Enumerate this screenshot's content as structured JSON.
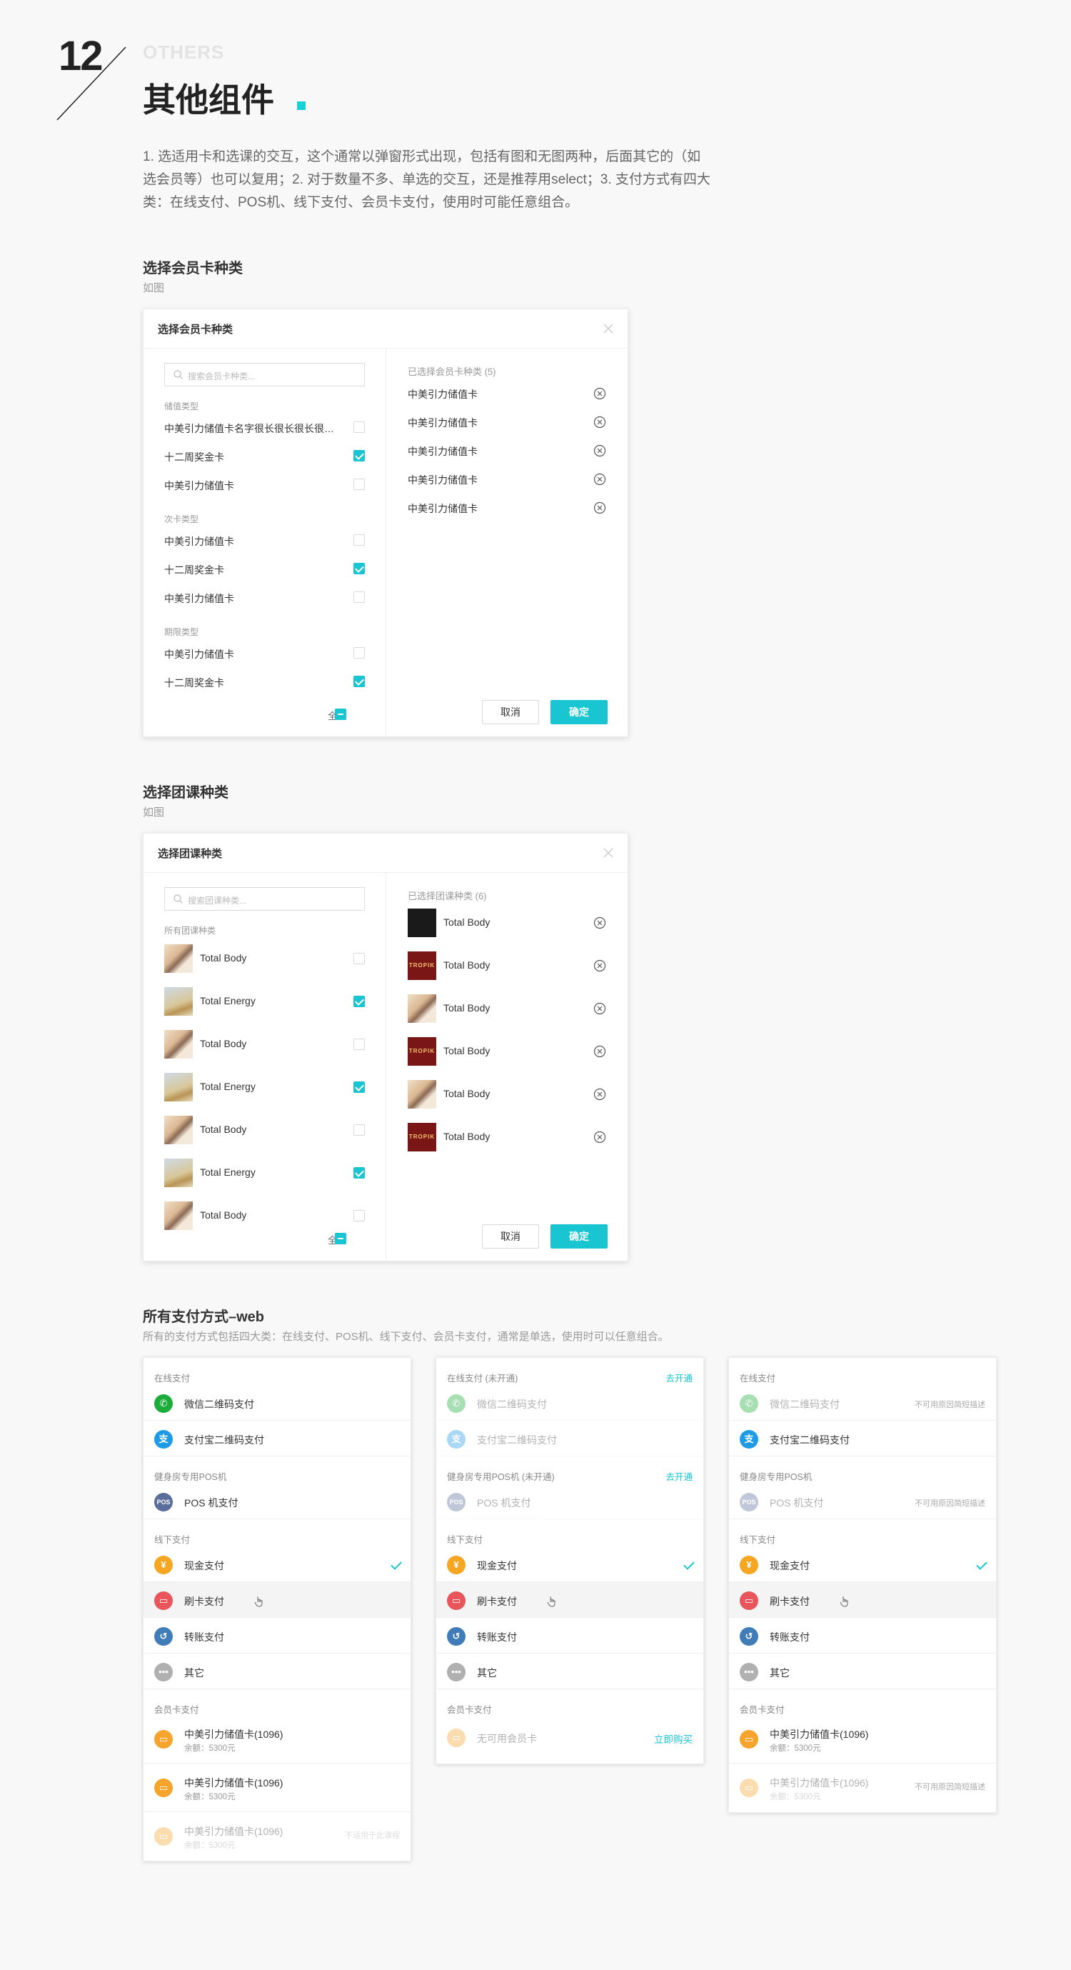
{
  "header": {
    "number": "12",
    "en_label": "OTHERS",
    "title": "其他组件",
    "intro": "1. 选适用卡和选课的交互，这个通常以弹窗形式出现，包括有图和无图两种，后面其它的（如选会员等）也可以复用；2. 对于数量不多、单选的交互，还是推荐用select；3. 支付方式有四大类：在线支付、POS机、线下支付、会员卡支付，使用时可能任意组合。"
  },
  "colors": {
    "accent": "#18c5d0",
    "text": "#333333",
    "muted": "#999999"
  },
  "card_section": {
    "title": "选择会员卡种类",
    "subtitle": "如图",
    "modal": {
      "title": "选择会员卡种类",
      "search_placeholder": "搜索会员卡种类...",
      "groups": [
        {
          "label": "储值类型",
          "items": [
            {
              "name": "中美引力储值卡名字很长很长很长很长很长",
              "checked": false
            },
            {
              "name": "十二周奖金卡",
              "checked": true
            },
            {
              "name": "中美引力储值卡",
              "checked": false
            }
          ]
        },
        {
          "label": "次卡类型",
          "items": [
            {
              "name": "中美引力储值卡",
              "checked": false
            },
            {
              "name": "十二周奖金卡",
              "checked": true
            },
            {
              "name": "中美引力储值卡",
              "checked": false
            }
          ]
        },
        {
          "label": "期限类型",
          "items": [
            {
              "name": "中美引力储值卡",
              "checked": false
            },
            {
              "name": "十二周奖金卡",
              "checked": true
            }
          ]
        }
      ],
      "select_all": "全选",
      "selected_header": "已选择会员卡种类 (5)",
      "selected": [
        "中美引力储值卡",
        "中美引力储值卡",
        "中美引力储值卡",
        "中美引力储值卡",
        "中美引力储值卡"
      ],
      "cancel": "取消",
      "confirm": "确定"
    }
  },
  "class_section": {
    "title": "选择团课种类",
    "subtitle": "如图",
    "modal": {
      "title": "选择团课种类",
      "search_placeholder": "搜索团课种类...",
      "group_label": "所有团课种类",
      "items": [
        {
          "name": "Total Body",
          "checked": false,
          "thumb": "body"
        },
        {
          "name": "Total Energy",
          "checked": true,
          "thumb": "energy"
        },
        {
          "name": "Total Body",
          "checked": false,
          "thumb": "body"
        },
        {
          "name": "Total Energy",
          "checked": true,
          "thumb": "energy"
        },
        {
          "name": "Total Body",
          "checked": false,
          "thumb": "body"
        },
        {
          "name": "Total Energy",
          "checked": true,
          "thumb": "energy"
        },
        {
          "name": "Total Body",
          "checked": false,
          "thumb": "body"
        }
      ],
      "select_all": "全选",
      "selected_header": "已选择团课种类 (6)",
      "selected": [
        {
          "name": "Total Body",
          "thumb": "dark"
        },
        {
          "name": "Total Body",
          "thumb": "tropik"
        },
        {
          "name": "Total Body",
          "thumb": "body"
        },
        {
          "name": "Total Body",
          "thumb": "tropik"
        },
        {
          "name": "Total Body",
          "thumb": "body"
        },
        {
          "name": "Total Body",
          "thumb": "tropik"
        }
      ],
      "tropik_text": "TROPIK",
      "cancel": "取消",
      "confirm": "确定"
    }
  },
  "payment_section": {
    "title": "所有支付方式–web",
    "subtitle": "所有的支付方式包括四大类：在线支付、POS机、线下支付、会员卡支付，通常是单选，使用时可以任意组合。",
    "cards": [
      {
        "online_label": "在线支付",
        "online_link": "",
        "wechat": "微信二维码支付",
        "wechat_note": "",
        "wechat_dim": false,
        "alipay": "支付宝二维码支付",
        "alipay_dim": false,
        "pos_label": "健身房专用POS机",
        "pos_link": "",
        "pos": "POS 机支付",
        "pos_note": "",
        "pos_dim": false,
        "offline_label": "线下支付",
        "cash": "现金支付",
        "card": "刷卡支付",
        "transfer": "转账支付",
        "other": "其它",
        "member_label": "会员卡支付",
        "members": [
          {
            "name": "中美引力储值卡(1096)",
            "balance": "余额：5300元",
            "note": "",
            "dim": false
          },
          {
            "name": "中美引力储值卡(1096)",
            "balance": "余额：5300元",
            "note": "",
            "dim": false
          },
          {
            "name": "中美引力储值卡(1096)",
            "balance": "余额：5300元",
            "note": "不适用于此课程",
            "dim": true
          }
        ]
      },
      {
        "online_label": "在线支付 (未开通)",
        "online_link": "去开通",
        "wechat": "微信二维码支付",
        "wechat_note": "",
        "wechat_dim": true,
        "alipay": "支付宝二维码支付",
        "alipay_dim": true,
        "pos_label": "健身房专用POS机 (未开通)",
        "pos_link": "去开通",
        "pos": "POS 机支付",
        "pos_note": "",
        "pos_dim": true,
        "offline_label": "线下支付",
        "cash": "现金支付",
        "card": "刷卡支付",
        "transfer": "转账支付",
        "other": "其它",
        "member_label": "会员卡支付",
        "no_member": "无可用会员卡",
        "buy_now": "立即购买"
      },
      {
        "online_label": "在线支付",
        "online_link": "",
        "wechat": "微信二维码支付",
        "wechat_note": "不可用原因简短描述",
        "wechat_dim": true,
        "alipay": "支付宝二维码支付",
        "alipay_dim": false,
        "pos_label": "健身房专用POS机",
        "pos_link": "",
        "pos": "POS 机支付",
        "pos_note": "不可用原因简短描述",
        "pos_dim": true,
        "offline_label": "线下支付",
        "cash": "现金支付",
        "card": "刷卡支付",
        "transfer": "转账支付",
        "other": "其它",
        "member_label": "会员卡支付",
        "members": [
          {
            "name": "中美引力储值卡(1096)",
            "balance": "余额：5300元",
            "note": "",
            "dim": false
          },
          {
            "name": "中美引力储值卡(1096)",
            "balance": "余额：5300元",
            "note": "不可用原因简短描述",
            "dim": true
          }
        ]
      }
    ]
  }
}
